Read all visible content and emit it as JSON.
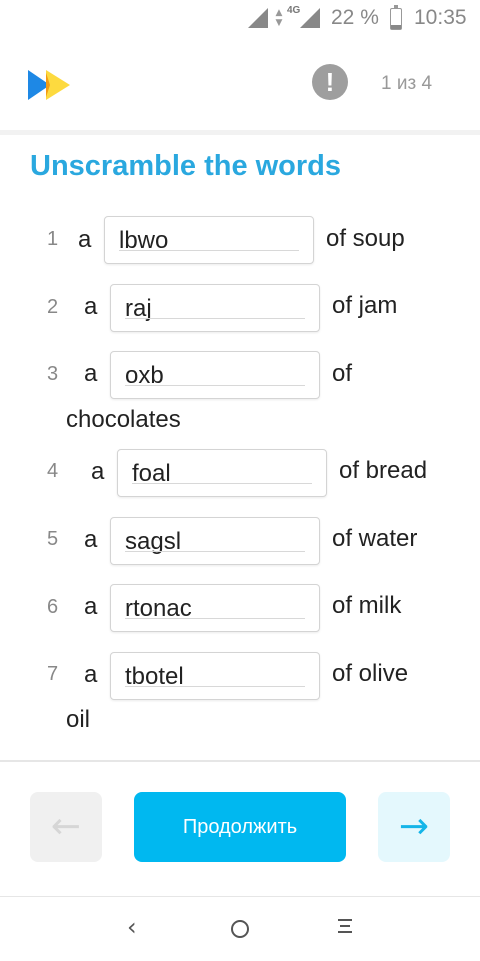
{
  "status_bar": {
    "network": "4G",
    "battery_percent": "22 %",
    "battery_level": 0.22,
    "time": "10:35"
  },
  "header": {
    "progress": "1 из 4",
    "info_icon": "!"
  },
  "title": "Unscramble the words",
  "items": [
    {
      "num": "1",
      "article": "a",
      "value": "lbwo",
      "after": "of soup",
      "cont": ""
    },
    {
      "num": "2",
      "article": "a",
      "value": "raj",
      "after": "of jam",
      "cont": ""
    },
    {
      "num": "3",
      "article": "a",
      "value": "oxb",
      "after": "of",
      "cont": "chocolates"
    },
    {
      "num": "4",
      "article": "a",
      "value": "foal",
      "after": "of bread",
      "cont": ""
    },
    {
      "num": "5",
      "article": "a",
      "value": "sagsl",
      "after": "of water",
      "cont": ""
    },
    {
      "num": "6",
      "article": "a",
      "value": "rtonac",
      "after": "of milk",
      "cont": ""
    },
    {
      "num": "7",
      "article": "a",
      "value": "tbotel",
      "after": "of olive",
      "cont": "oil"
    }
  ],
  "footer": {
    "prev_icon": "←",
    "continue_label": "Продолжить",
    "next_icon": "→"
  },
  "navbar": {
    "back_icon": "‹"
  },
  "colors": {
    "accent": "#2aa8df",
    "button": "#00b8f0",
    "logo_blue": "#1e88e5",
    "logo_yellow": "#fdd835"
  }
}
